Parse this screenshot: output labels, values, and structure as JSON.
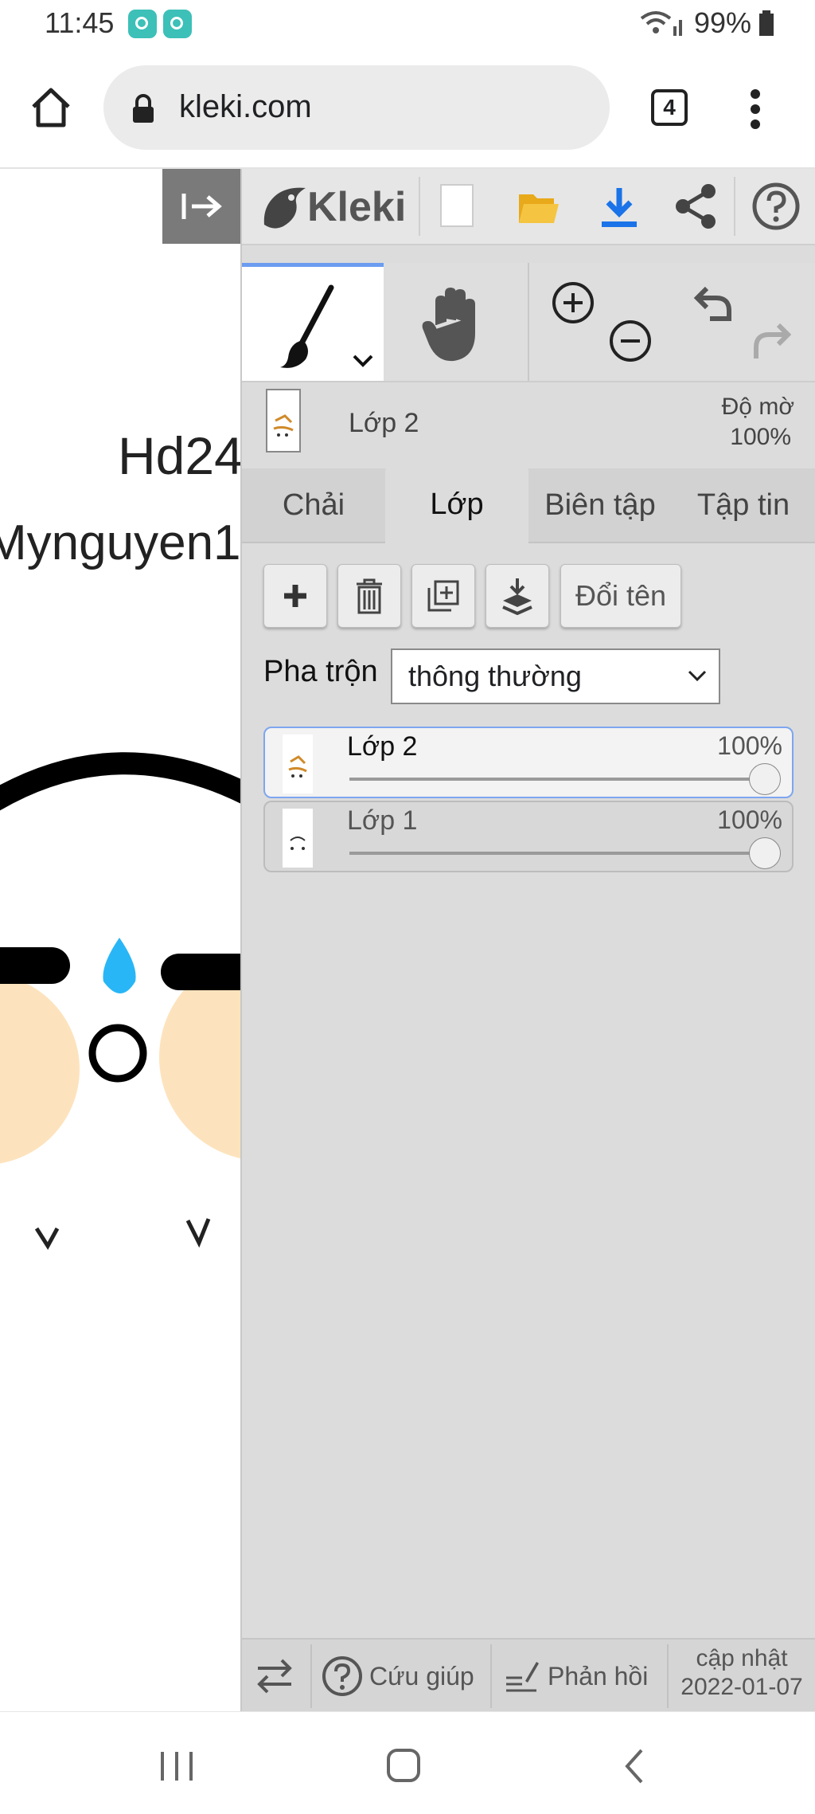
{
  "status_bar": {
    "time": "11:45",
    "battery": "99%"
  },
  "browser": {
    "url": "kleki.com",
    "tab_count": "4"
  },
  "canvas": {
    "text_line1": "Hd24",
    "text_line2": "Mynguyen1"
  },
  "app": {
    "name": "Kleki"
  },
  "current_layer": {
    "name": "Lớp 2",
    "opacity_label": "Độ mờ",
    "opacity_value": "100%"
  },
  "tabs": [
    {
      "label": "Chải"
    },
    {
      "label": "Lớp"
    },
    {
      "label": "Biên tập"
    },
    {
      "label": "Tập tin"
    }
  ],
  "layer_actions": {
    "rename_label": "Đổi tên"
  },
  "blend": {
    "label": "Pha trộn",
    "value": "thông thường"
  },
  "layers": [
    {
      "name": "Lớp 2",
      "opacity": "100%",
      "opacity_level": 1.0
    },
    {
      "name": "Lớp 1",
      "opacity": "100%",
      "opacity_level": 1.0
    }
  ],
  "footer": {
    "help_label": "Cứu giúp",
    "feedback_label": "Phản hồi",
    "update_line1": "cập nhật",
    "update_line2": "2022-01-07"
  },
  "colors": {
    "accent": "#6b9cf0",
    "download_blue": "#1a73e8",
    "folder_yellow": "#f5b731",
    "canvas_blue": "#29b6f6",
    "skin": "#fde3bd"
  }
}
